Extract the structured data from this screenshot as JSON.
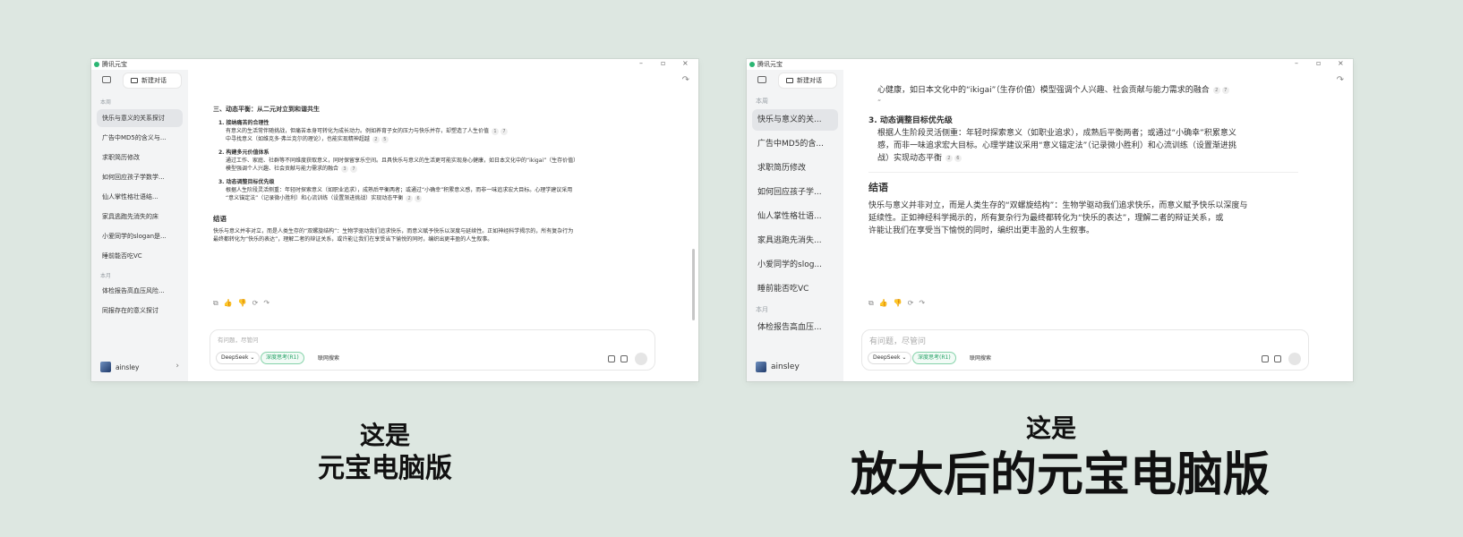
{
  "captions": {
    "left_line1": "这是",
    "left_line2": "元宝电脑版",
    "right_line1": "这是",
    "right_line2": "放大后的元宝电脑版"
  },
  "app": {
    "title": "腾讯元宝",
    "new_chat": "新建对话",
    "window_controls": [
      "–",
      "▫",
      "×"
    ]
  },
  "sidebar": {
    "section_week": "本周",
    "section_month": "本月",
    "items_small": [
      "快乐与意义的关系探讨",
      "广告中MD5的含义与...",
      "求职简历修改",
      "如何回应孩子学数学...",
      "仙人掌性格壮语结...",
      "家具逃跑先消失的床",
      "小爱同学的slogan是...",
      "睡前能否吃VC"
    ],
    "items_month_small": [
      "体检报告高血压风险...",
      "同报存在的意义探讨"
    ],
    "items_large": [
      "快乐与意义的关...",
      "广告中MD5的含...",
      "求职简历修改",
      "如何回应孩子学...",
      "仙人掌性格壮语...",
      "家具逃跑先消失...",
      "小爱同学的slog...",
      "睡前能否吃VC"
    ],
    "items_month_large": [
      "体检报告高血压..."
    ],
    "user": "ainsley"
  },
  "small": {
    "section3": "三、动态平衡：从二元对立到和谐共生",
    "p1_title": "1. 接纳痛苦的合理性",
    "p1_line1": "有意义的生活常伴随挑战，但痛苦本身可转化为成长动力。例如养育子女的压力与快乐并存，却塑造了人生价值",
    "p1_line2": "中寻找意义（如维克多·弗兰克尔的理论），也能实现精神超越",
    "p2_title": "2. 构建多元价值体系",
    "p2_line1": "通过工作、家庭、社群等不同维度获取意义，同时保留享乐空间。且具快乐与意义的生活更可能实现身心健康，如日本文化中的“ikigai”（生存价值）",
    "p2_line2": "模型强调个人兴趣、社会贡献与能力需求的融合",
    "p3_title": "3. 动态调整目标优先级",
    "p3_line1": "根据人生阶段灵活侧重：年轻时探索意义（如职业追求），成熟后平衡两者；或通过“小确幸”积累意义感，而非一味追求宏大目标。心理学建议采用",
    "p3_line2": "“意义锚定法”（记录微小胜利）和心流训练（设置渐进挑战）实现动态平衡",
    "conclusion": "结语",
    "c_line1": "快乐与意义并非对立，而是人类生存的“双螺旋结构”：生物学驱动我们追求快乐，而意义赋予快乐以深度与延续性。正如神经科学揭示的，所有复杂行为",
    "c_line2": "最终都转化为“快乐的表达”，理解二者的辩证关系，或许能让我们在享受当下愉悦的同时，编织出更丰盈的人生叙事。",
    "placeholder": "有问题，尽管问",
    "model": "DeepSeek ⌄",
    "deep_think": "深度思考(R1)",
    "web_search": "联网搜索"
  },
  "large": {
    "line0": "心健康，如日本文化中的“ikigai”（生存价值）模型强调个人兴趣、社会贡献与能力需求的融合",
    "p3_title": "3. 动态调整目标优先级",
    "p3_l1": "根据人生阶段灵活侧重：年轻时探索意义（如职业追求），成熟后平衡两者；或通过“小确幸”积累意义",
    "p3_l2": "感，而非一味追求宏大目标。心理学建议采用“意义锚定法”（记录微小胜利）和心流训练（设置渐进挑",
    "p3_l3": "战）实现动态平衡",
    "conclusion": "结语",
    "c_l1": "快乐与意义并非对立，而是人类生存的“双螺旋结构”：生物学驱动我们追求快乐，而意义赋予快乐以深度与",
    "c_l2": "延续性。正如神经科学揭示的，所有复杂行为最终都转化为“快乐的表达”，理解二者的辩证关系，或",
    "c_l3": "许能让我们在享受当下愉悦的同时，编织出更丰盈的人生叙事。",
    "placeholder": "有问题，尽管问",
    "model": "DeepSeek ⌄",
    "deep_think": "深度思考(R1)",
    "web_search": "联网搜索"
  },
  "citations": {
    "a": [
      "1",
      "7"
    ],
    "b": [
      "2",
      "5"
    ],
    "c": [
      "3",
      "7"
    ],
    "d": [
      "2",
      "6"
    ],
    "e": [
      "3",
      "5"
    ],
    "f": [
      "2",
      "7"
    ]
  }
}
